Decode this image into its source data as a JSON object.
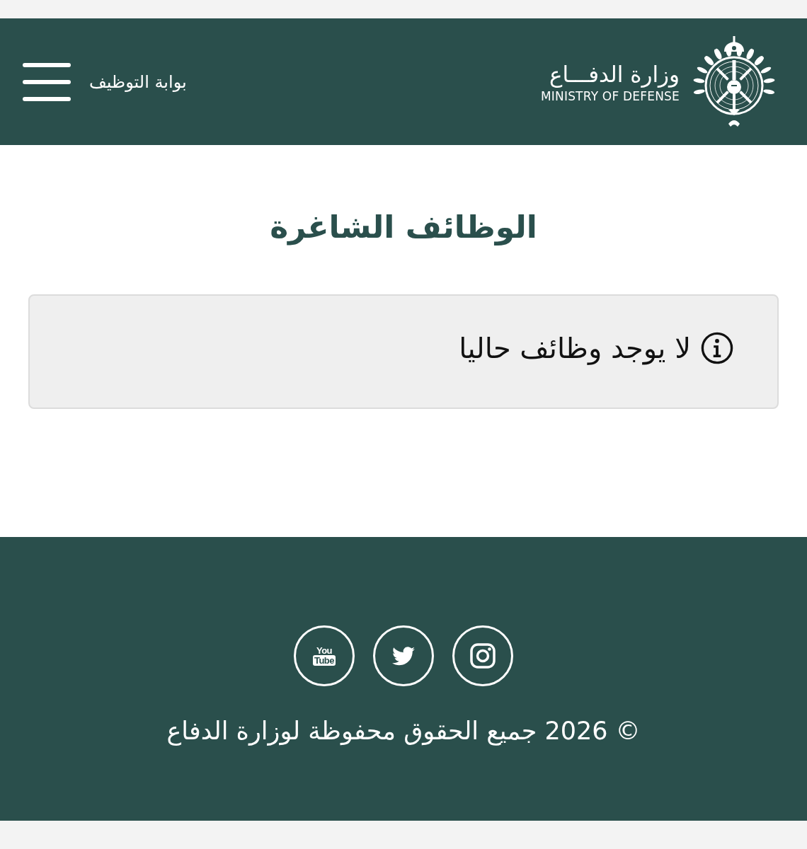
{
  "header": {
    "logo": {
      "arabic_name": "وزارة الدفـــاع",
      "english_name": "MINISTRY OF DEFENSE"
    },
    "portal_title": "بوابة التوظيف"
  },
  "page": {
    "title": "الوظائف الشاغرة",
    "notice": {
      "kind": "info",
      "message": "لا يوجد وظائف حاليا"
    }
  },
  "footer": {
    "social_links": [
      {
        "kind": "instagram"
      },
      {
        "kind": "twitter"
      },
      {
        "kind": "youtube",
        "logo_text": "You",
        "logo_tile_text": "Tube"
      }
    ],
    "copyright": "© 2026 جميع الحقوق محفوظة لوزارة الدفاع"
  }
}
